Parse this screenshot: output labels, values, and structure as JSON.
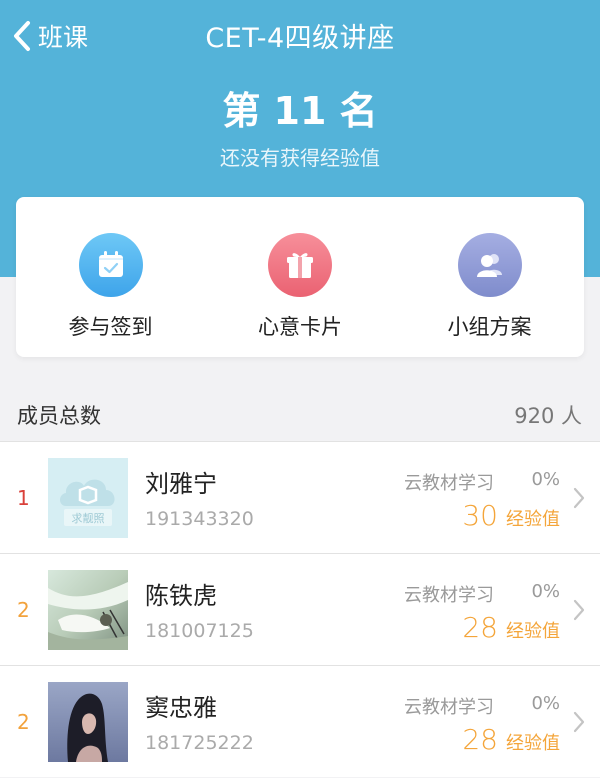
{
  "nav": {
    "back_label": "班课",
    "title": "CET-4四级讲座"
  },
  "rank": {
    "title": "第 11 名",
    "subtitle": "还没有获得经验值"
  },
  "actions": [
    {
      "label": "参与签到",
      "icon": "calendar-check-icon",
      "color": "#4fb1ee"
    },
    {
      "label": "心意卡片",
      "icon": "gift-icon",
      "color": "#ef7584"
    },
    {
      "label": "小组方案",
      "icon": "group-icon",
      "color": "#919bd6"
    }
  ],
  "members": {
    "label": "成员总数",
    "count": "920 人",
    "list": [
      {
        "rank": "1",
        "rank_color": "#d9413a",
        "name": "刘雅宁",
        "id": "191343320",
        "source": "云教材学习",
        "percent": "0%",
        "xp": "30",
        "xp_unit": "经验值",
        "avatar": "placeholder-avatar",
        "avatar_text": "求靓照"
      },
      {
        "rank": "2",
        "rank_color": "#f2a23c",
        "name": "陈铁虎",
        "id": "181007125",
        "source": "云教材学习",
        "percent": "0%",
        "xp": "28",
        "xp_unit": "经验值",
        "avatar": "anime-avatar"
      },
      {
        "rank": "2",
        "rank_color": "#f2a23c",
        "name": "窦忠雅",
        "id": "181725222",
        "source": "云教材学习",
        "percent": "0%",
        "xp": "28",
        "xp_unit": "经验值",
        "avatar": "photo-avatar"
      }
    ]
  },
  "colors": {
    "header": "#54b3d9",
    "accent": "#f4a53a"
  }
}
